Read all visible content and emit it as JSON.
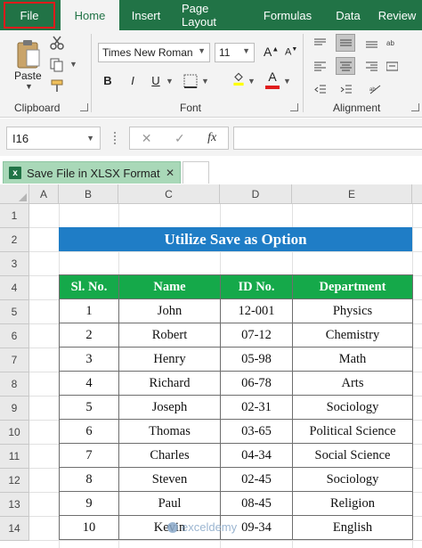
{
  "tabs": {
    "file": "File",
    "home": "Home",
    "insert": "Insert",
    "page_layout": "Page Layout",
    "formulas": "Formulas",
    "data": "Data",
    "review": "Review"
  },
  "ribbon": {
    "paste_label": "Paste",
    "clipboard_label": "Clipboard",
    "font_label": "Font",
    "alignment_label": "Alignment",
    "font_name": "Times New Roman",
    "font_size": "11",
    "bold": "B",
    "italic": "I",
    "underline": "U",
    "grow_font": "A",
    "shrink_font": "A",
    "font_color_letter": "A"
  },
  "formula_bar": {
    "name_box": "I16",
    "cancel": "✕",
    "confirm": "✓",
    "fx": "fx",
    "formula": ""
  },
  "sheet_tab": {
    "name": "Save File in XLSX Format",
    "icon_letter": "x",
    "close": "✕"
  },
  "columns": [
    "A",
    "B",
    "C",
    "D",
    "E"
  ],
  "rows": [
    "1",
    "2",
    "3",
    "4",
    "5",
    "6",
    "7",
    "8",
    "9",
    "10",
    "11",
    "12",
    "13",
    "14"
  ],
  "sheet": {
    "title": "Utilize Save as Option",
    "headers": [
      "Sl. No.",
      "Name",
      "ID No.",
      "Department"
    ],
    "records": [
      [
        "1",
        "John",
        "12-001",
        "Physics"
      ],
      [
        "2",
        "Robert",
        "07-12",
        "Chemistry"
      ],
      [
        "3",
        "Henry",
        "05-98",
        "Math"
      ],
      [
        "4",
        "Richard",
        "06-78",
        "Arts"
      ],
      [
        "5",
        "Joseph",
        "02-31",
        "Sociology"
      ],
      [
        "6",
        "Thomas",
        "03-65",
        "Political Science"
      ],
      [
        "7",
        "Charles",
        "04-34",
        "Social Science"
      ],
      [
        "8",
        "Steven",
        "02-45",
        "Sociology"
      ],
      [
        "9",
        "Paul",
        "08-45",
        "Religion"
      ],
      [
        "10",
        "Kevin",
        "09-34",
        "English"
      ]
    ]
  },
  "watermark": "exceldemy",
  "colors": {
    "ribbon_green": "#217346",
    "title_blue": "#1f7dc6",
    "header_green": "#15a94a",
    "file_highlight": "#e01b1b"
  }
}
